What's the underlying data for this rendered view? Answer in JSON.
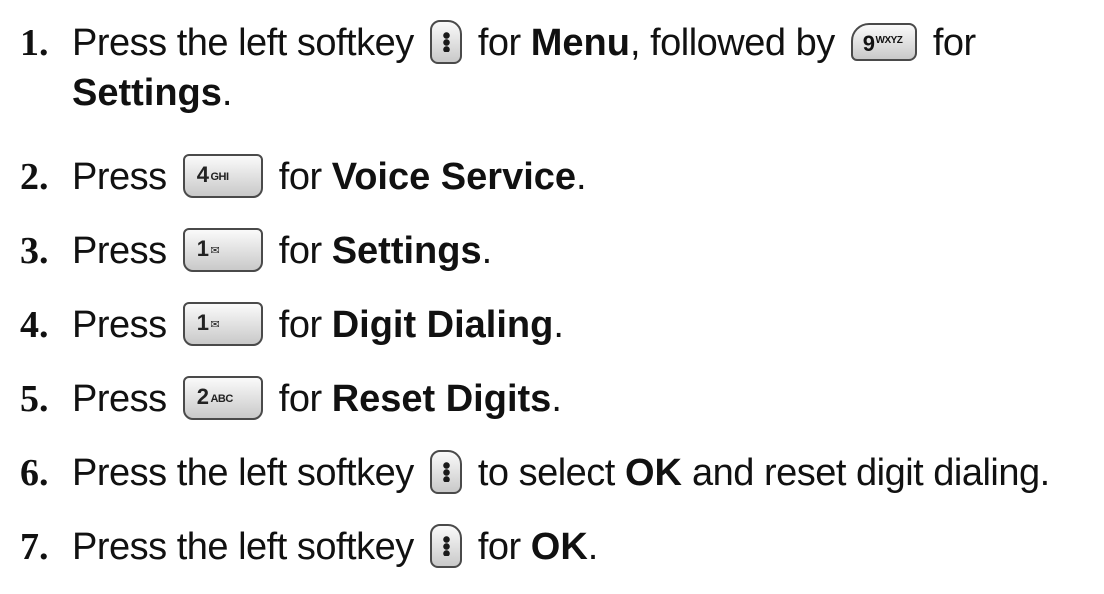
{
  "steps": [
    {
      "num": "1.",
      "t1": "Press the left softkey",
      "t2": "for",
      "b1": "Menu",
      "t3": ", followed by",
      "t4": "for",
      "b2": "Settings",
      "t5": "."
    },
    {
      "num": "2.",
      "t1": "Press",
      "t2": "for",
      "b1": "Voice Service",
      "t3": "."
    },
    {
      "num": "3.",
      "t1": "Press",
      "t2": "for",
      "b1": "Settings",
      "t3": "."
    },
    {
      "num": "4.",
      "t1": "Press",
      "t2": "for",
      "b1": "Digit Dialing",
      "t3": "."
    },
    {
      "num": "5.",
      "t1": "Press",
      "t2": "for",
      "b1": "Reset Digits",
      "t3": "."
    },
    {
      "num": "6.",
      "t1": "Press the left softkey",
      "t2": "to select",
      "b1": "OK",
      "t3": "and reset digit dialing."
    },
    {
      "num": "7.",
      "t1": "Press the left softkey",
      "t2": "for",
      "b1": "OK",
      "t3": "."
    }
  ],
  "keys": {
    "nine": {
      "digit": "9",
      "letters": "WXYZ"
    },
    "four": {
      "digit": "4",
      "letters": "GHI"
    },
    "one": {
      "digit": "1",
      "letters": "✉"
    },
    "two": {
      "digit": "2",
      "letters": "ABC"
    }
  }
}
